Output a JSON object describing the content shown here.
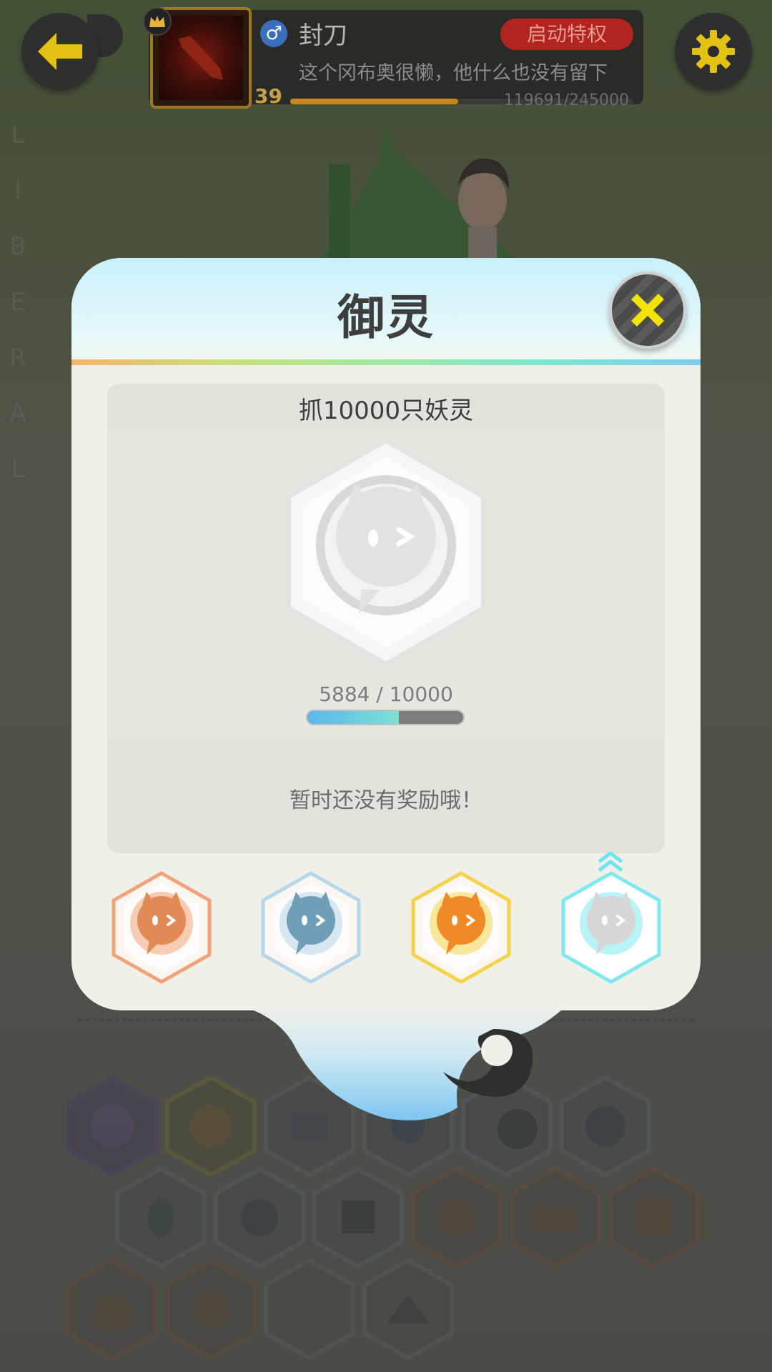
{
  "header": {
    "username": "封刀",
    "gender_icon": "♂",
    "vip_button_label": "启动特权",
    "bio": "这个冈布奥很懒，他什么也没有留下",
    "level": "39",
    "xp_text": "119691/245000",
    "xp_fraction": 0.4886
  },
  "background": {
    "letters": [
      "L",
      "I",
      "B",
      "E",
      "R",
      "A",
      "L"
    ]
  },
  "modal": {
    "title": "御灵",
    "achievement": {
      "title": "抓10000只妖灵",
      "progress_text": "5884 / 10000",
      "progress_fraction": 0.5884,
      "reward_text": "暂时还没有奖励哦！"
    },
    "tiers": [
      {
        "name": "bronze",
        "color": "#f0a27a",
        "inner": "#e28a55"
      },
      {
        "name": "silver",
        "color": "#b6d6ea",
        "inner": "#6f9fb8"
      },
      {
        "name": "gold",
        "color": "#f4d34a",
        "inner": "#f08a26"
      },
      {
        "name": "platinum",
        "color": "#7fe9f0",
        "inner": "#d6d6d6",
        "selected": true
      }
    ]
  },
  "colors": {
    "accent_yellow": "#f0d000",
    "close_x": "#f2e400",
    "vip_red": "#b3241f"
  }
}
